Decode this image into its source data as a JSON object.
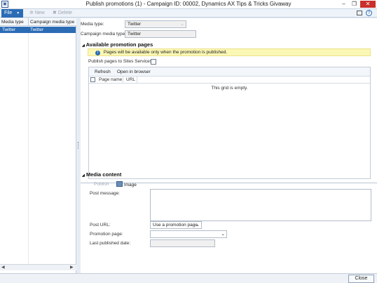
{
  "window": {
    "title": "Publish promotions (1) - Campaign ID: 00002, Dynamics AX Tips & Tricks Givaway",
    "app_icon": "ax-app-icon",
    "controls": [
      "minimize",
      "restore",
      "close"
    ]
  },
  "toolbar": {
    "file_label": "File",
    "new_label": "New",
    "delete_label": "Delete",
    "right_icons": [
      "window-icon",
      "help-icon"
    ]
  },
  "list": {
    "columns": [
      "Media type",
      "Campaign media type"
    ],
    "rows": [
      {
        "media_type": "Twitter",
        "campaign_media_type": "Twitter"
      }
    ]
  },
  "form": {
    "media_type_label": "Media type:",
    "media_type_value": "Twitter",
    "campaign_media_type_label": "Campaign media type:",
    "campaign_media_type_value": "Twitter"
  },
  "available_pages": {
    "header": "Available promotion pages",
    "info_text": "Pages will be available only when the promotion is published.",
    "publish_to_sites_label": "Publish pages to Sites Services:",
    "refresh_label": "Refresh",
    "open_browser_label": "Open in browser",
    "grid_columns": [
      "Page name",
      "URL"
    ],
    "empty_text": "This grid is empty."
  },
  "media_content": {
    "header": "Media content",
    "publish_label": "Publish",
    "image_label": "Image",
    "post_message_label": "Post message:",
    "post_message_value": "",
    "post_url_label": "Post URL:",
    "post_url_value": "Use a promotion page",
    "promotion_page_label": "Promotion page:",
    "promotion_page_value": "",
    "last_published_label": "Last published date:",
    "last_published_value": ""
  },
  "footer": {
    "close_label": "Close"
  }
}
